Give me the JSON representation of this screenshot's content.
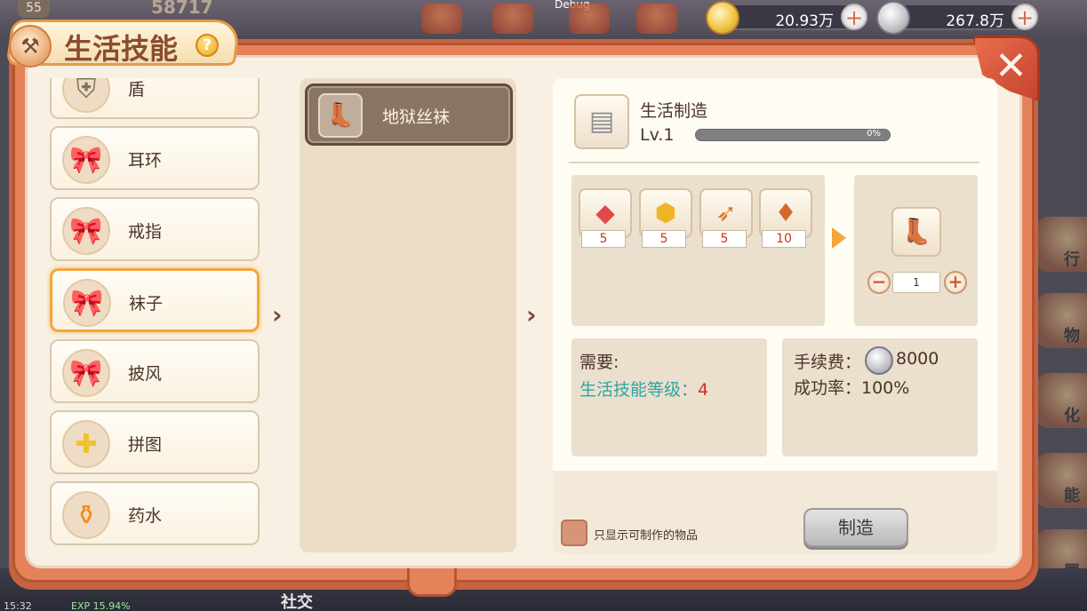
{
  "hud": {
    "player_level": "55",
    "power_value": "58717",
    "debug_label": "Debug",
    "gold_amount": "20.93万",
    "silver_amount": "267.8万",
    "side_labels": [
      "行",
      "物",
      "化",
      "能",
      "置"
    ],
    "status_time": "15:32",
    "exp_text": "EXP 15.94%",
    "social_label": "社交"
  },
  "window": {
    "title": "生活技能",
    "help_label": "?",
    "close_label": "✕"
  },
  "categories": [
    {
      "label": "盾",
      "icon": "shield-icon"
    },
    {
      "label": "耳环",
      "icon": "bow-icon"
    },
    {
      "label": "戒指",
      "icon": "bow-icon"
    },
    {
      "label": "袜子",
      "icon": "bow-icon",
      "selected": true
    },
    {
      "label": "披风",
      "icon": "bow-icon"
    },
    {
      "label": "拼图",
      "icon": "puzzle-icon"
    },
    {
      "label": "药水",
      "icon": "potion-icon"
    }
  ],
  "items": [
    {
      "name": "地狱丝袜",
      "icon": "boots-icon"
    }
  ],
  "skill": {
    "name": "生活制造",
    "level": "Lv.1",
    "progress": 0,
    "progress_text": "0%"
  },
  "materials": [
    {
      "icon": "crystal-icon",
      "count": "5"
    },
    {
      "icon": "gold-ore-icon",
      "count": "5"
    },
    {
      "icon": "feather-icon",
      "count": "5"
    },
    {
      "icon": "gem-icon",
      "count": "10"
    }
  ],
  "result": {
    "icon": "boots-icon",
    "quantity": "1",
    "minus_label": "−",
    "plus_label": "+"
  },
  "requirements": {
    "title": "需要:",
    "skill_level_label": "生活技能等级：",
    "skill_level_value": "4"
  },
  "fee": {
    "label": "手续费：",
    "value": "8000",
    "success_rate": "成功率：100%"
  },
  "footer": {
    "checkbox_label": "只显示可制作的物品",
    "craft_button": "制造"
  }
}
